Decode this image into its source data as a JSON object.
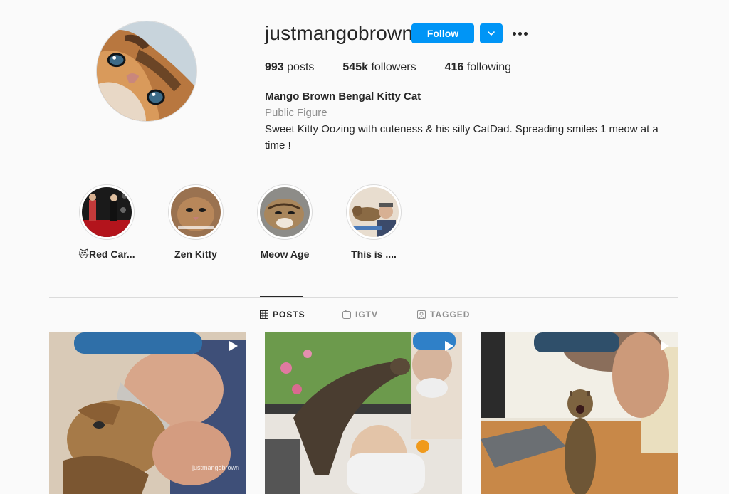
{
  "profile": {
    "username": "justmangobrown",
    "follow_label": "Follow",
    "stats": {
      "posts_count": "993",
      "posts_label": "posts",
      "followers_count": "545k",
      "followers_label": "followers",
      "following_count": "416",
      "following_label": "following"
    },
    "bio": {
      "name": "Mango Brown Bengal Kitty Cat",
      "category": "Public Figure",
      "text": "Sweet Kitty Oozing with cuteness & his silly CatDad. Spreading smiles 1 meow at a time !"
    }
  },
  "highlights": [
    {
      "label": "😻Red Car..."
    },
    {
      "label": "Zen Kitty"
    },
    {
      "label": "Meow Age"
    },
    {
      "label": "This is ...."
    }
  ],
  "tabs": [
    {
      "label": "POSTS",
      "icon": "grid-icon",
      "active": true
    },
    {
      "label": "IGTV",
      "icon": "igtv-icon",
      "active": false
    },
    {
      "label": "TAGGED",
      "icon": "tagged-icon",
      "active": false
    }
  ],
  "posts": [
    {
      "watermark": "justmangobrown",
      "icon": "video-play-icon"
    },
    {
      "icon": "video-play-icon"
    },
    {
      "icon": "video-play-icon"
    }
  ],
  "colors": {
    "accent": "#0095f6",
    "background": "#fafafa",
    "text": "#262626",
    "secondary_text": "#8e8e8e"
  }
}
